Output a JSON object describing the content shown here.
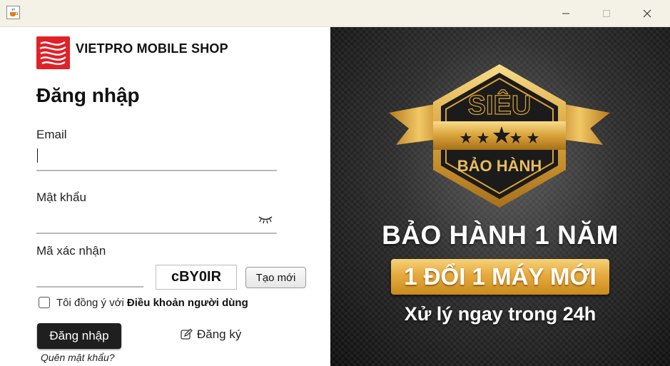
{
  "window": {
    "icon": "java-cup-icon",
    "controls": [
      "minimize-icon",
      "maximize-icon",
      "close-icon"
    ]
  },
  "brand": {
    "name": "VIETPRO MOBILE SHOP",
    "logo_color": "#e02128"
  },
  "form": {
    "title": "Đăng nhập",
    "email_label": "Email",
    "email_value": "",
    "password_label": "Mật khẩu",
    "password_value": "",
    "captcha_label": "Mã xác nhận",
    "captcha_value": "",
    "captcha_code": "cBY0IR",
    "refresh_label": "Tạo mới",
    "agree_text": "Tôi đồng ý với",
    "terms_link": "Điều khoản người dùng",
    "agree_checked": false,
    "login_button": "Đăng nhập",
    "register_link": "Đăng ký",
    "forgot_link": "Quên mật khẩu?"
  },
  "banner": {
    "badge_top": "SIÊU",
    "badge_bottom": "BẢO HÀNH",
    "line1": "BẢO HÀNH 1 NĂM",
    "line2": "1 ĐỔI 1 MÁY MỚI",
    "line3": "Xử lý ngay trong 24h",
    "gold": "#e6aa3d",
    "background": "#1a1a1a"
  }
}
